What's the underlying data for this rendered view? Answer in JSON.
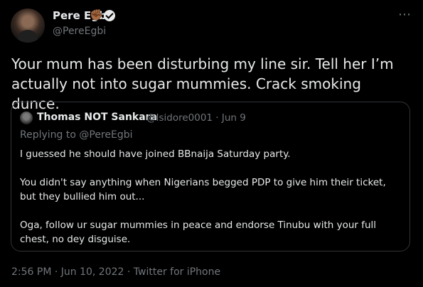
{
  "author": {
    "name": "Pere Egbi",
    "emoji": "✊🏾",
    "handle": "@PereEgbi"
  },
  "more_icon": "⋯",
  "tweet": {
    "text": "Your mum has been disturbing my line sir. Tell her I’m actually not into sugar mummies. Crack smoking dunce."
  },
  "quote": {
    "name": "Thomas NOT Sankara",
    "handle_date": "@Isidore0001 · Jun 9",
    "replying_prefix": "Replying to ",
    "replying_handle": "@PereEgbi",
    "paragraphs": [
      "I guessed he should have joined BBnaija Saturday party.",
      "You didn't say anything when Nigerians begged PDP to give him their ticket, but they bullied him out...",
      "Oga, follow ur sugar mummies in peace and endorse Tinubu with your full chest, no dey disguise."
    ]
  },
  "meta": {
    "timestamp": "2:56 PM · Jun 10, 2022 · Twitter for iPhone"
  }
}
